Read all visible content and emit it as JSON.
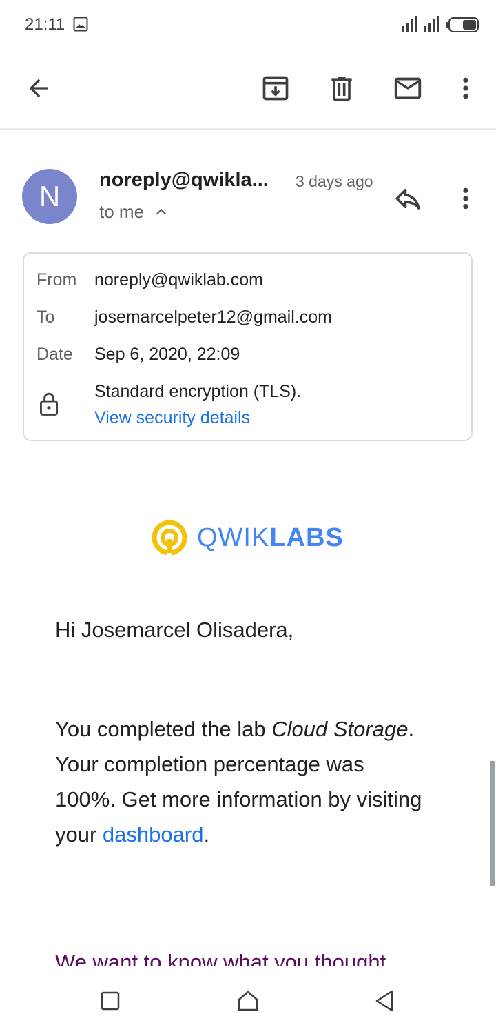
{
  "status_bar": {
    "time": "21:11"
  },
  "toolbar": {
    "back": "back-arrow-icon",
    "archive": "archive-icon",
    "delete": "trash-icon",
    "mark_unread": "mail-icon",
    "more": "more-vert-icon"
  },
  "message": {
    "avatar_letter": "N",
    "sender": "noreply@qwikla...",
    "time": "3 days ago",
    "recipient_summary": "to me",
    "avatar_color": "#7986cb"
  },
  "details": {
    "from_label": "From",
    "from_value": "noreply@qwiklab.com",
    "to_label": "To",
    "to_value": "josemarcelpeter12@gmail.com",
    "date_label": "Date",
    "date_value": "Sep 6, 2020, 22:09",
    "encryption": "Standard encryption (TLS).",
    "security_link": "View security details"
  },
  "email_body": {
    "logo": "QWIKLABS",
    "greeting": "Hi Josemarcel Olisadera,",
    "para_1": "You completed the lab ",
    "lab_name": "Cloud Storage",
    "para_2": ". Your completion percentage was 100%. Get more information by visiting your ",
    "dashboard_link": "dashboard",
    "para_end": ".",
    "feedback_text": "We want to know what you thought"
  },
  "colors": {
    "link": "#1a73e8",
    "logo_yellow": "#f4c20d",
    "logo_blue": "#4285f4",
    "feedback_purple": "#5c0e5e"
  }
}
